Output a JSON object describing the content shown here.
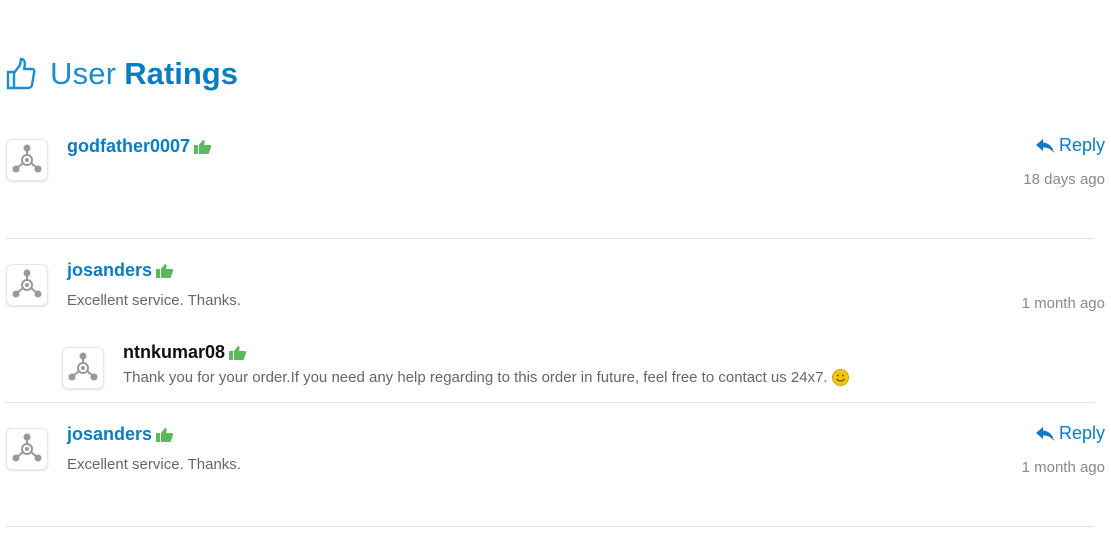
{
  "header": {
    "title_light": "User",
    "title_bold": "Ratings"
  },
  "reviews": [
    {
      "username": "godfather0007",
      "comment": "",
      "time": "18 days ago",
      "reply_label": "Reply"
    },
    {
      "username": "josanders",
      "comment": "Excellent service. Thanks.",
      "time": "1 month ago",
      "reply": {
        "username": "ntnkumar08",
        "comment": "Thank you for your order.If you need any help regarding to this order in future, feel free to contact us 24x7."
      }
    },
    {
      "username": "josanders",
      "comment": "Excellent service. Thanks.",
      "time": "1 month ago",
      "reply_label": "Reply"
    }
  ],
  "colors": {
    "accent": "#0a7cc1",
    "positive": "#5cb85c",
    "divider": "#e3e3e3"
  },
  "icons": {
    "header": "thumbs-up-outline-icon",
    "rating": "thumbs-up-icon",
    "reply": "reply-arrow-icon",
    "avatar": "default-avatar-icon",
    "emoji": "smiley-icon"
  }
}
